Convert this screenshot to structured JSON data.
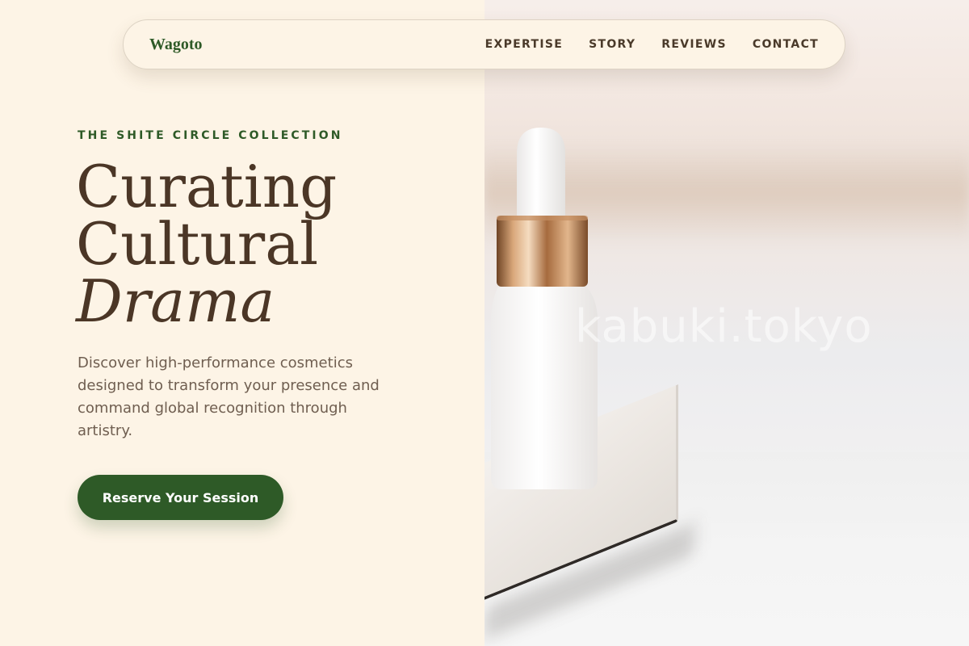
{
  "brand": {
    "name": "Wagoto"
  },
  "nav": {
    "links": [
      {
        "label": "EXPERTISE"
      },
      {
        "label": "STORY"
      },
      {
        "label": "REVIEWS"
      },
      {
        "label": "CONTACT"
      }
    ]
  },
  "hero": {
    "eyebrow": "THE SHITE CIRCLE COLLECTION",
    "headline": {
      "line1": "Curating",
      "line2": "Cultural",
      "accent": "Drama"
    },
    "description": "Discover high-performance cosmetics designed to transform your presence and command global recognition through artistry.",
    "cta_label": "Reserve Your Session"
  },
  "image": {
    "watermark": "kabuki.tokyo"
  },
  "colors": {
    "background": "#fdf4e6",
    "brand_green": "#2e5a27",
    "heading_brown": "#4b3626",
    "body_text": "#6f5e50"
  }
}
